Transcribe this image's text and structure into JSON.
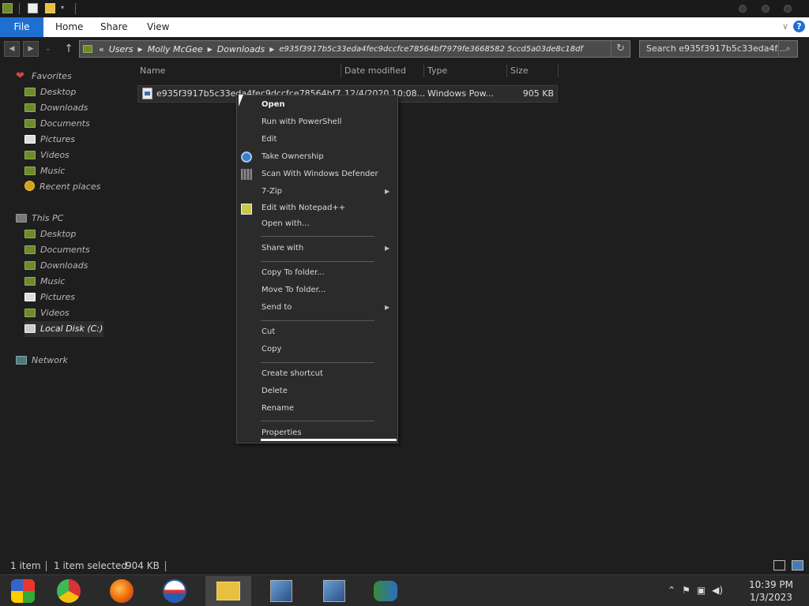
{
  "ribbon": {
    "file": "File",
    "tabs": [
      "Home",
      "Share",
      "View"
    ]
  },
  "address": {
    "prefix": "«",
    "crumbs": [
      "Users",
      "Molly McGee",
      "Downloads",
      "e935f3917b5c33eda4fec9dccfce78564bf7979fe3668582 5ccd5a03de8c18df"
    ],
    "search_placeholder": "Search e935f3917b5c33eda4f..."
  },
  "nav": {
    "favorites": "Favorites",
    "fav_items": [
      "Desktop",
      "Downloads",
      "Documents",
      "Pictures",
      "Videos",
      "Music",
      "Recent places"
    ],
    "this_pc": "This PC",
    "pc_items": [
      "Desktop",
      "Documents",
      "Downloads",
      "Music",
      "Pictures",
      "Videos",
      "Local Disk (C:)"
    ],
    "network": "Network"
  },
  "columns": {
    "name": "Name",
    "date": "Date modified",
    "type": "Type",
    "size": "Size"
  },
  "file": {
    "name": "e935f3917b5c33eda4fec9dccfce78564bf7...",
    "date": "12/4/2020 10:08...",
    "type": "Windows Pow...",
    "size": "905 KB"
  },
  "menu": {
    "open": "Open",
    "run_ps": "Run with PowerShell",
    "edit": "Edit",
    "take_ownership": "Take Ownership",
    "scan": "Scan With Windows Defender",
    "zip": "7-Zip",
    "npp": "Edit with Notepad++",
    "open_with": "Open with...",
    "share_with": "Share with",
    "copy_to": "Copy To folder...",
    "move_to": "Move To folder...",
    "send_to": "Send to",
    "cut": "Cut",
    "copy": "Copy",
    "create_shortcut": "Create shortcut",
    "delete": "Delete",
    "rename": "Rename",
    "properties": "Properties"
  },
  "status": {
    "count": "1 item",
    "selected": "1 item selected",
    "size": "904 KB"
  },
  "clock": {
    "time": "10:39 PM",
    "date": "1/3/2023"
  },
  "colors": {
    "accent": "#1f6fd1",
    "background": "#1e1e1e",
    "menu_bg": "#2b2b2b"
  }
}
